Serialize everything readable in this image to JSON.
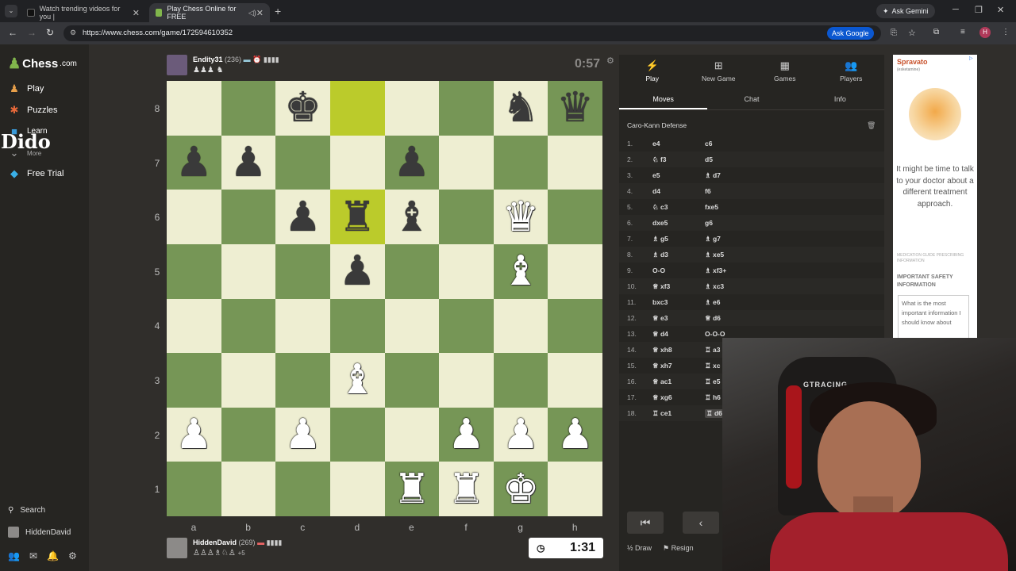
{
  "browser": {
    "tabs": [
      {
        "title": "Watch trending videos for you |"
      },
      {
        "title": "Play Chess Online for FREE"
      }
    ],
    "gemini_label": "Ask Gemini",
    "url": "https://www.chess.com/game/172594610352",
    "ask_google_label": "Ask Google",
    "profile_initial": "H"
  },
  "sidebar": {
    "logo": "Chess",
    "logo_suffix": ".com",
    "items": [
      {
        "label": "Play",
        "icon": "play-pawn-icon"
      },
      {
        "label": "Puzzles",
        "icon": "puzzle-icon"
      },
      {
        "label": "Learn",
        "icon": "learn-icon"
      },
      {
        "label": "More",
        "icon": "more-icon"
      },
      {
        "label": "Free Trial",
        "icon": "diamond-icon"
      }
    ],
    "overlay_text": "Dido",
    "search_label": "Search",
    "username": "HiddenDavid"
  },
  "game": {
    "top_player": {
      "name": "Endity31",
      "rating": "(236)",
      "captured": "♟♟♟ ♞"
    },
    "top_clock": "0:57",
    "bottom_player": {
      "name": "HiddenDavid",
      "rating": "(269)",
      "captured": "♙♙♙♗♘♙",
      "advantage": "+5"
    },
    "bottom_clock": "1:31",
    "ranks": [
      "8",
      "7",
      "6",
      "5",
      "4",
      "3",
      "2",
      "1"
    ],
    "files": [
      "a",
      "b",
      "c",
      "d",
      "e",
      "f",
      "g",
      "h"
    ],
    "board": [
      [
        "",
        "",
        "bk",
        "",
        "",
        "",
        "bn",
        "bq"
      ],
      [
        "bp",
        "bp",
        "",
        "",
        "bp",
        "",
        "",
        ""
      ],
      [
        "",
        "",
        "bp",
        "br",
        "bb",
        "",
        "wq",
        ""
      ],
      [
        "",
        "",
        "",
        "bp",
        "",
        "",
        "wb",
        ""
      ],
      [
        "",
        "",
        "",
        "",
        "",
        "",
        "",
        ""
      ],
      [
        "",
        "",
        "",
        "wb",
        "",
        "",
        "",
        ""
      ],
      [
        "wp",
        "",
        "wp",
        "",
        "",
        "wp",
        "wp",
        "wp"
      ],
      [
        "",
        "",
        "",
        "",
        "wr",
        "wr",
        "wk",
        ""
      ]
    ],
    "highlight_squares": [
      "d8",
      "d6"
    ]
  },
  "panel": {
    "tabs": [
      {
        "label": "Play",
        "icon": "play-icon"
      },
      {
        "label": "New Game",
        "icon": "plus-icon"
      },
      {
        "label": "Games",
        "icon": "games-icon"
      },
      {
        "label": "Players",
        "icon": "players-icon"
      }
    ],
    "subtabs": [
      "Moves",
      "Chat",
      "Info"
    ],
    "opening": "Caro-Kann Defense",
    "moves": [
      {
        "no": "1.",
        "w": "e4",
        "b": "c6"
      },
      {
        "no": "2.",
        "w": "♘ f3",
        "b": "d5"
      },
      {
        "no": "3.",
        "w": "e5",
        "b": "♗ d7"
      },
      {
        "no": "4.",
        "w": "d4",
        "b": "f6"
      },
      {
        "no": "5.",
        "w": "♘ c3",
        "b": "fxe5"
      },
      {
        "no": "6.",
        "w": "dxe5",
        "b": "g6"
      },
      {
        "no": "7.",
        "w": "♗ g5",
        "b": "♗ g7"
      },
      {
        "no": "8.",
        "w": "♗ d3",
        "b": "♗ xe5"
      },
      {
        "no": "9.",
        "w": "O-O",
        "b": "♗ xf3+"
      },
      {
        "no": "10.",
        "w": "♕ xf3",
        "b": "♗ xc3"
      },
      {
        "no": "11.",
        "w": "bxc3",
        "b": "♗ e6"
      },
      {
        "no": "12.",
        "w": "♕ e3",
        "b": "♕ d6"
      },
      {
        "no": "13.",
        "w": "♕ d4",
        "b": "O-O-O"
      },
      {
        "no": "14.",
        "w": "♕ xh8",
        "b": "♖ a3"
      },
      {
        "no": "15.",
        "w": "♕ xh7",
        "b": "♖ xc"
      },
      {
        "no": "16.",
        "w": "♕ ac1",
        "b": "♖ e5"
      },
      {
        "no": "17.",
        "w": "♕ xg6",
        "b": "♖ h6"
      },
      {
        "no": "18.",
        "w": "♖ ce1",
        "b": "♖ d6"
      }
    ],
    "draw_label": "Draw",
    "resign_label": "Resign"
  },
  "ad": {
    "brand": "Spravato",
    "brand_sub": "(esketamine)",
    "message": "It might be time to talk to your doctor about a different treatment approach.",
    "guide": "MEDICATION GUIDE PRESCRIBING INFORMATION",
    "safety": "IMPORTANT SAFETY INFORMATION",
    "box_text": "What is the most important information I should know about"
  },
  "webcam": {
    "chair_text": "GTRACING"
  },
  "colors": {
    "light_square": "#eeeed2",
    "dark_square": "#769656",
    "highlight": "#bbcb2b",
    "accent": "#81b64c"
  }
}
